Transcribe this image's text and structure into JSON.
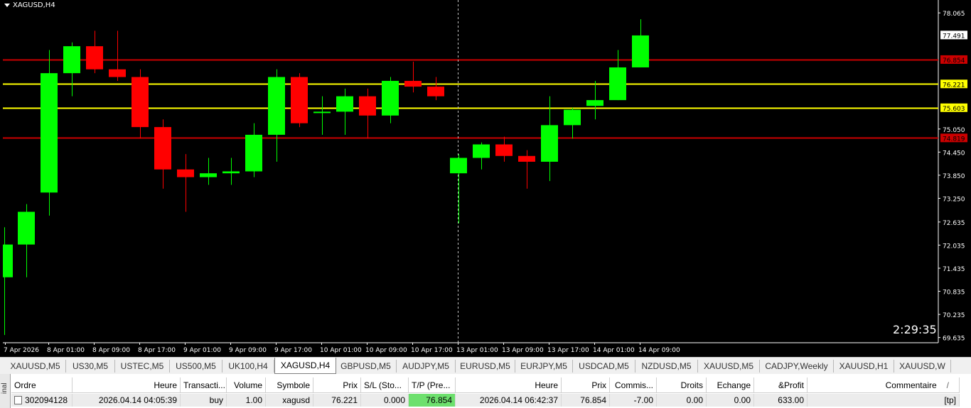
{
  "chart": {
    "title": "XAGUSD,H4",
    "countdown": "2:29:35",
    "colors": {
      "bull": "#00ff00",
      "bear": "#ff0000",
      "bg": "#000000",
      "axis": "#ffffff",
      "grid_sep": "#c0c0c0",
      "level_red": "#cc0000",
      "level_yellow": "#ffff00"
    }
  },
  "chart_data": {
    "type": "candlestick",
    "symbol": "XAGUSD",
    "timeframe": "H4",
    "ylim": [
      69.5,
      78.4
    ],
    "y_ticks": [
      "78.065",
      "77.491",
      "76.854",
      "76.221",
      "75.603",
      "75.050",
      "74.819",
      "74.450",
      "73.850",
      "73.250",
      "72.635",
      "72.035",
      "71.435",
      "70.835",
      "70.235",
      "69.635"
    ],
    "x_ticks": [
      "7 Apr 2026",
      "8 Apr 01:00",
      "8 Apr 09:00",
      "8 Apr 17:00",
      "9 Apr 01:00",
      "9 Apr 09:00",
      "9 Apr 17:00",
      "10 Apr 01:00",
      "10 Apr 09:00",
      "10 Apr 17:00",
      "13 Apr 01:00",
      "13 Apr 09:00",
      "13 Apr 17:00",
      "14 Apr 01:00",
      "14 Apr 09:00"
    ],
    "horizontal_levels": [
      {
        "price": 76.854,
        "label": "76.854",
        "color": "red"
      },
      {
        "price": 76.221,
        "label": "76.221",
        "color": "yellow"
      },
      {
        "price": 75.603,
        "label": "75.603",
        "color": "yellow"
      },
      {
        "price": 74.819,
        "label": "74.819",
        "color": "red"
      }
    ],
    "current_price_label": "77.491",
    "period_separator": "13 Apr 01:00",
    "candles": [
      {
        "o": 71.2,
        "h": 72.5,
        "l": 69.7,
        "c": 72.05
      },
      {
        "o": 72.05,
        "h": 73.1,
        "l": 71.2,
        "c": 72.9
      },
      {
        "o": 73.4,
        "h": 77.1,
        "l": 72.8,
        "c": 76.5
      },
      {
        "o": 76.5,
        "h": 77.3,
        "l": 75.9,
        "c": 77.2
      },
      {
        "o": 77.2,
        "h": 77.6,
        "l": 76.5,
        "c": 76.6
      },
      {
        "o": 76.6,
        "h": 77.6,
        "l": 76.3,
        "c": 76.4
      },
      {
        "o": 76.4,
        "h": 76.6,
        "l": 74.8,
        "c": 75.1
      },
      {
        "o": 75.1,
        "h": 75.3,
        "l": 73.5,
        "c": 74.0
      },
      {
        "o": 74.0,
        "h": 74.4,
        "l": 72.9,
        "c": 73.8
      },
      {
        "o": 73.8,
        "h": 74.3,
        "l": 73.6,
        "c": 73.9
      },
      {
        "o": 73.9,
        "h": 74.3,
        "l": 73.6,
        "c": 73.95
      },
      {
        "o": 73.95,
        "h": 75.2,
        "l": 73.8,
        "c": 74.9
      },
      {
        "o": 74.9,
        "h": 76.6,
        "l": 74.2,
        "c": 76.4
      },
      {
        "o": 76.4,
        "h": 76.5,
        "l": 75.1,
        "c": 75.2
      },
      {
        "o": 75.5,
        "h": 75.9,
        "l": 74.9,
        "c": 75.5
      },
      {
        "o": 75.5,
        "h": 76.1,
        "l": 74.9,
        "c": 75.9
      },
      {
        "o": 75.9,
        "h": 76.1,
        "l": 74.8,
        "c": 75.4
      },
      {
        "o": 75.4,
        "h": 76.4,
        "l": 75.2,
        "c": 76.3
      },
      {
        "o": 76.3,
        "h": 76.8,
        "l": 76.0,
        "c": 76.15
      },
      {
        "o": 76.15,
        "h": 76.4,
        "l": 75.8,
        "c": 75.9
      },
      {
        "o": 73.9,
        "h": 74.4,
        "l": 72.6,
        "c": 74.3
      },
      {
        "o": 74.3,
        "h": 74.7,
        "l": 74.0,
        "c": 74.65
      },
      {
        "o": 74.65,
        "h": 74.85,
        "l": 74.2,
        "c": 74.35
      },
      {
        "o": 74.35,
        "h": 74.5,
        "l": 73.5,
        "c": 74.2
      },
      {
        "o": 74.2,
        "h": 75.9,
        "l": 73.7,
        "c": 75.15
      },
      {
        "o": 75.15,
        "h": 75.6,
        "l": 74.8,
        "c": 75.55
      },
      {
        "o": 75.65,
        "h": 76.3,
        "l": 75.3,
        "c": 75.8
      },
      {
        "o": 75.8,
        "h": 77.1,
        "l": 75.8,
        "c": 76.65
      },
      {
        "o": 76.65,
        "h": 77.9,
        "l": 76.65,
        "c": 77.48
      }
    ]
  },
  "tabs": [
    {
      "label": "XAUUSD,M5",
      "active": false
    },
    {
      "label": "US30,M5",
      "active": false
    },
    {
      "label": "USTEC,M5",
      "active": false
    },
    {
      "label": "US500,M5",
      "active": false
    },
    {
      "label": "UK100,H4",
      "active": false
    },
    {
      "label": "XAGUSD,H4",
      "active": true
    },
    {
      "label": "GBPUSD,M5",
      "active": false
    },
    {
      "label": "AUDJPY,M5",
      "active": false
    },
    {
      "label": "EURUSD,M5",
      "active": false
    },
    {
      "label": "EURJPY,M5",
      "active": false
    },
    {
      "label": "USDCAD,M5",
      "active": false
    },
    {
      "label": "NZDUSD,M5",
      "active": false
    },
    {
      "label": "XAUUSD,M5",
      "active": false
    },
    {
      "label": "CADJPY,Weekly",
      "active": false
    },
    {
      "label": "XAUUSD,H1",
      "active": false
    },
    {
      "label": "XAUUSD,W",
      "active": false
    }
  ],
  "terminal": {
    "side_label": "inal",
    "columns": [
      "Ordre",
      "Heure",
      "Transacti...",
      "Volume",
      "Symbole",
      "Prix",
      "S/L (Sto...",
      "T/P (Pre...",
      "Heure",
      "Prix",
      "Commis...",
      "Droits",
      "Echange",
      "&Profit",
      "Commentaire"
    ],
    "sort_indicator": "/",
    "rows": [
      [
        "302094128",
        "2026.04.14 04:05:39",
        "buy",
        "1.00",
        "xagusd",
        "76.221",
        "0.000",
        "76.854",
        "2026.04.14 06:42:37",
        "76.854",
        "-7.00",
        "0.00",
        "0.00",
        "633.00",
        "[tp]"
      ]
    ]
  }
}
